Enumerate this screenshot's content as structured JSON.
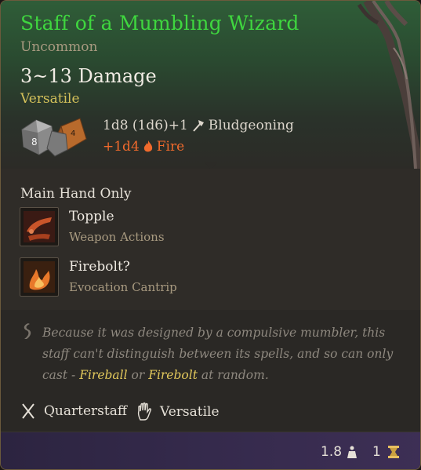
{
  "item": {
    "name": "Staff of a Mumbling Wizard",
    "rarity": "Uncommon",
    "damage": "3~13 Damage",
    "versatile": "Versatile",
    "die_label": "8",
    "damage_primary": "1d8 (1d6)+1",
    "damage_primary_type": "Bludgeoning",
    "damage_bonus": "+1d4",
    "damage_bonus_type": "Fire"
  },
  "actions": {
    "label": "Main Hand Only",
    "items": [
      {
        "name": "Topple",
        "sub": "Weapon Actions",
        "icon": "topple-icon"
      },
      {
        "name": "Firebolt?",
        "sub": "Evocation Cantrip",
        "icon": "firebolt-icon"
      }
    ]
  },
  "description": {
    "text_1": "Because it was designed by a compulsive mumbler, this staff can't distinguish between its spells, and so can only cast - ",
    "kw_1": "Fireball",
    "text_2": " or ",
    "kw_2": "Firebolt",
    "text_3": " at random."
  },
  "properties": [
    {
      "label": "Quarterstaff",
      "icon": "crossed-staves-icon"
    },
    {
      "label": "Versatile",
      "icon": "hand-icon"
    }
  ],
  "footer": {
    "weight": "1.8",
    "value": "1"
  },
  "colors": {
    "title": "#3fd63f",
    "keyword": "#e3c95c",
    "fire": "#f06a2c"
  }
}
